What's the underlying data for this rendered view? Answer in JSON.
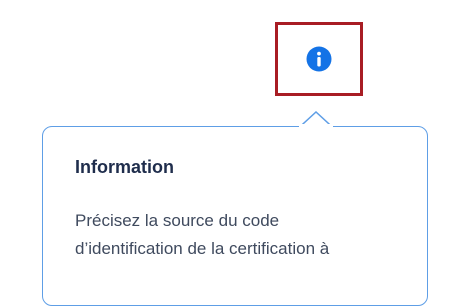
{
  "info_button": {
    "icon": "info-icon",
    "icon_color": "#1473e6",
    "highlight_color": "#a81d24"
  },
  "popover": {
    "title": "Information",
    "body_lines": [
      "Précisez la source du code",
      "d’identification de la certification à"
    ],
    "border_color": "#5e9ee6",
    "title_color": "#1f2d4c",
    "text_color": "#3f4a5e"
  }
}
